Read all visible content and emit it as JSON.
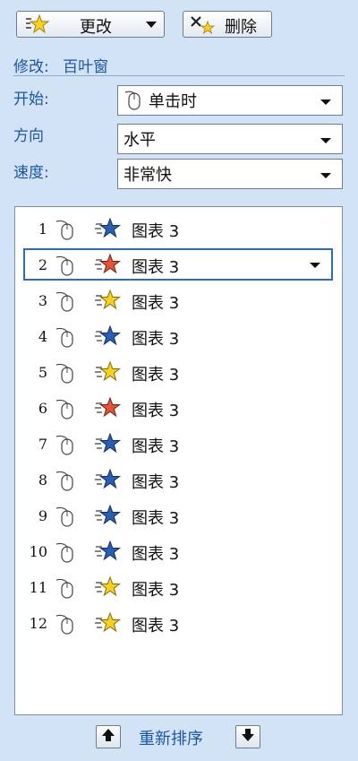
{
  "toolbar": {
    "change_label": "更改",
    "delete_label": "删除"
  },
  "modify": {
    "prefix": "修改:",
    "effect_name": "百叶窗"
  },
  "fields": {
    "start": {
      "label": "开始:",
      "value": "单击时"
    },
    "direction": {
      "label": "方向",
      "value": "水平"
    },
    "speed": {
      "label": "速度:",
      "value": "非常快"
    }
  },
  "list": {
    "items": [
      {
        "num": "1",
        "name": "图表 3",
        "effect_icon": "blue-star-icon"
      },
      {
        "num": "2",
        "name": "图表 3",
        "effect_icon": "red-star-icon",
        "selected": true
      },
      {
        "num": "3",
        "name": "图表 3",
        "effect_icon": "yellow-star-icon"
      },
      {
        "num": "4",
        "name": "图表 3",
        "effect_icon": "blue-star-icon"
      },
      {
        "num": "5",
        "name": "图表 3",
        "effect_icon": "yellow-star-icon"
      },
      {
        "num": "6",
        "name": "图表 3",
        "effect_icon": "red-star-icon"
      },
      {
        "num": "7",
        "name": "图表 3",
        "effect_icon": "blue-star-icon"
      },
      {
        "num": "8",
        "name": "图表 3",
        "effect_icon": "blue-star-icon"
      },
      {
        "num": "9",
        "name": "图表 3",
        "effect_icon": "blue-star-icon"
      },
      {
        "num": "10",
        "name": "图表 3",
        "effect_icon": "blue-star-icon"
      },
      {
        "num": "11",
        "name": "图表 3",
        "effect_icon": "yellow-star-icon"
      },
      {
        "num": "12",
        "name": "图表 3",
        "effect_icon": "yellow-star-icon"
      }
    ]
  },
  "reorder": {
    "label": "重新排序",
    "up_icon": "arrow-up-icon",
    "down_icon": "arrow-down-icon"
  },
  "colors": {
    "panel_bg": "#d3e3f6",
    "label_blue": "#1b55a6",
    "selection_border": "#2a6bbd"
  }
}
